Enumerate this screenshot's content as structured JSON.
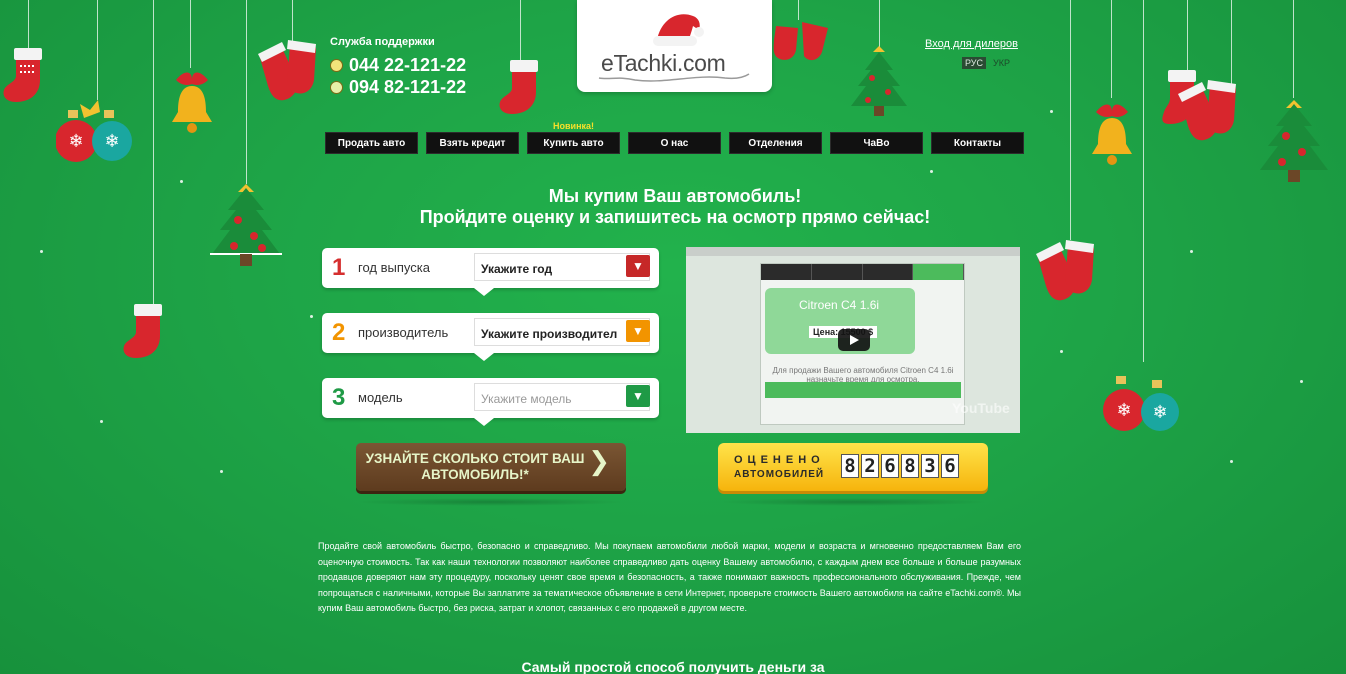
{
  "support": {
    "title": "Служба поддержки",
    "phones": [
      "044 22-121-22",
      "094 82-121-22"
    ]
  },
  "logo": {
    "text": "eTachki.com"
  },
  "header": {
    "dealers_link": "Вход для дилеров",
    "languages": [
      {
        "label": "РУС",
        "active": true
      },
      {
        "label": "УКР",
        "active": false
      }
    ]
  },
  "nav": {
    "badge": "Новинка!",
    "items": [
      "Продать авто",
      "Взять кредит",
      "Купить авто",
      "О нас",
      "Отделения",
      "ЧаВо",
      "Контакты"
    ]
  },
  "headline": {
    "line1": "Мы купим Ваш автомобиль!",
    "line2": "Пройдите оценку и запишитесь на осмотр прямо сейчас!"
  },
  "form": {
    "steps": [
      {
        "num": "1",
        "label": "год выпуска",
        "value": "Укажите год",
        "accent": "#d52e2e",
        "arrow_color": "#c62828",
        "placeholder": false
      },
      {
        "num": "2",
        "label": "производитель",
        "value": "Укажите производител",
        "accent": "#f29400",
        "arrow_color": "#f29400",
        "placeholder": false
      },
      {
        "num": "3",
        "label": "модель",
        "value": "Укажите модель",
        "accent": "#1f9a46",
        "arrow_color": "#1f9a46",
        "placeholder": true
      }
    ],
    "submit": "УЗНАЙТЕ СКОЛЬКО СТОИТ ВАШ АВТОМОБИЛЬ!*"
  },
  "video": {
    "car_name": "Citroen C4 1.6i",
    "price": "Цена: 15500 $",
    "caption": "Для продажи Вашего автомобиля Citroen C4 1.6i назначьте время для осмотра.",
    "watermark": "YouTube"
  },
  "counter": {
    "label_top": "ОЦЕНЕНО",
    "label_bottom": "АВТОМОБИЛЕЙ",
    "digits": [
      "8",
      "2",
      "6",
      "8",
      "3",
      "6"
    ]
  },
  "description": "Продайте свой автомобиль быстро, безопасно и справедливо. Мы покупаем автомобили любой марки, модели и возраста и мгновенно предоставляем Вам его оценочную стоимость. Так как наши технологии позволяют наиболее справедливо дать оценку Вашему автомобилю, с каждым днем все больше и больше разумных продавцов доверяют нам эту процедуру, поскольку ценят свое время и безопасность, а также понимают важность профессионального обслуживания. Прежде, чем попрощаться с наличными, которые Вы заплатите за тематическое объявление в сети Интернет, проверьте стоимость Вашего автомобиля на сайте eTachki.com®. Мы купим Ваш автомобиль быстро, без риска, затрат и хлопот, связанных с его продажей в другом месте.",
  "bottom_heading": "Самый простой способ получить деньги за",
  "colors": {
    "background": "#1ea447",
    "nav_bg": "#111111",
    "cta": "#6b4727",
    "counter": "#f8c51b"
  }
}
